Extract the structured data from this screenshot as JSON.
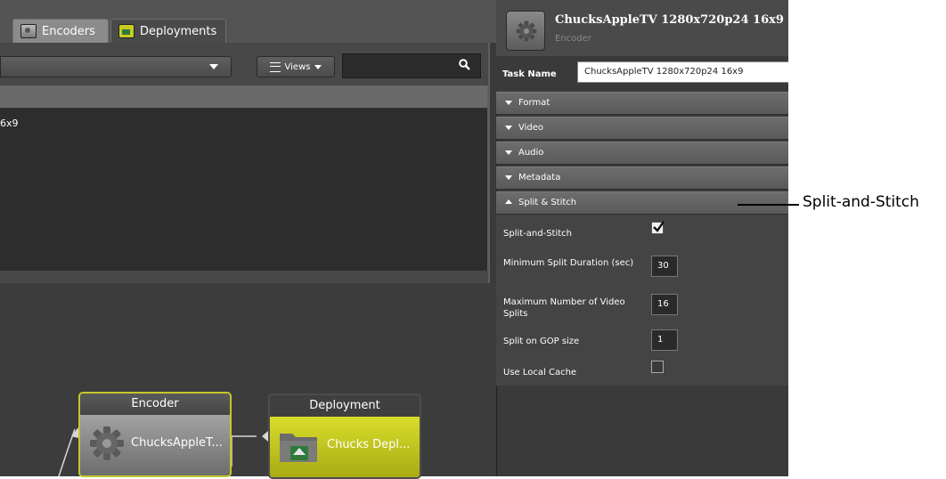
{
  "tabs": [
    {
      "label": "Encoders"
    },
    {
      "label": "Deployments"
    }
  ],
  "toolbar": {
    "views_label": "Views"
  },
  "list": {
    "rows": [
      {
        "text": "6x9"
      }
    ]
  },
  "workflow": {
    "encoder_node": {
      "header": "Encoder",
      "label": "ChucksAppleT..."
    },
    "deploy_node": {
      "header": "Deployment",
      "label": "Chucks Depl..."
    }
  },
  "inspector": {
    "title": "ChucksAppleTV 1280x720p24 16x9",
    "subtitle": "Encoder",
    "task_name_label": "Task Name",
    "task_name_value": "ChucksAppleTV 1280x720p24 16x9",
    "sections": [
      {
        "label": "Format",
        "expanded": false
      },
      {
        "label": "Video",
        "expanded": false
      },
      {
        "label": "Audio",
        "expanded": false
      },
      {
        "label": "Metadata",
        "expanded": false
      },
      {
        "label": "Split & Stitch",
        "expanded": true
      }
    ],
    "split": {
      "split_and_stitch_label": "Split-and-Stitch",
      "split_and_stitch_checked": true,
      "min_duration_label": "Minimum Split Duration (sec)",
      "min_duration_value": "30",
      "max_splits_label": "Maximum Number of Video Splits",
      "max_splits_value": "16",
      "gop_label": "Split on GOP size",
      "gop_value": "1",
      "local_cache_label": "Use Local Cache",
      "local_cache_checked": false
    }
  },
  "callout": {
    "text": "Split-and-Stitch"
  },
  "colors": {
    "accent_yellow": "#c5c82a",
    "deploy_fill": "#c8cc22",
    "panel_bg": "#3a3a3a"
  }
}
